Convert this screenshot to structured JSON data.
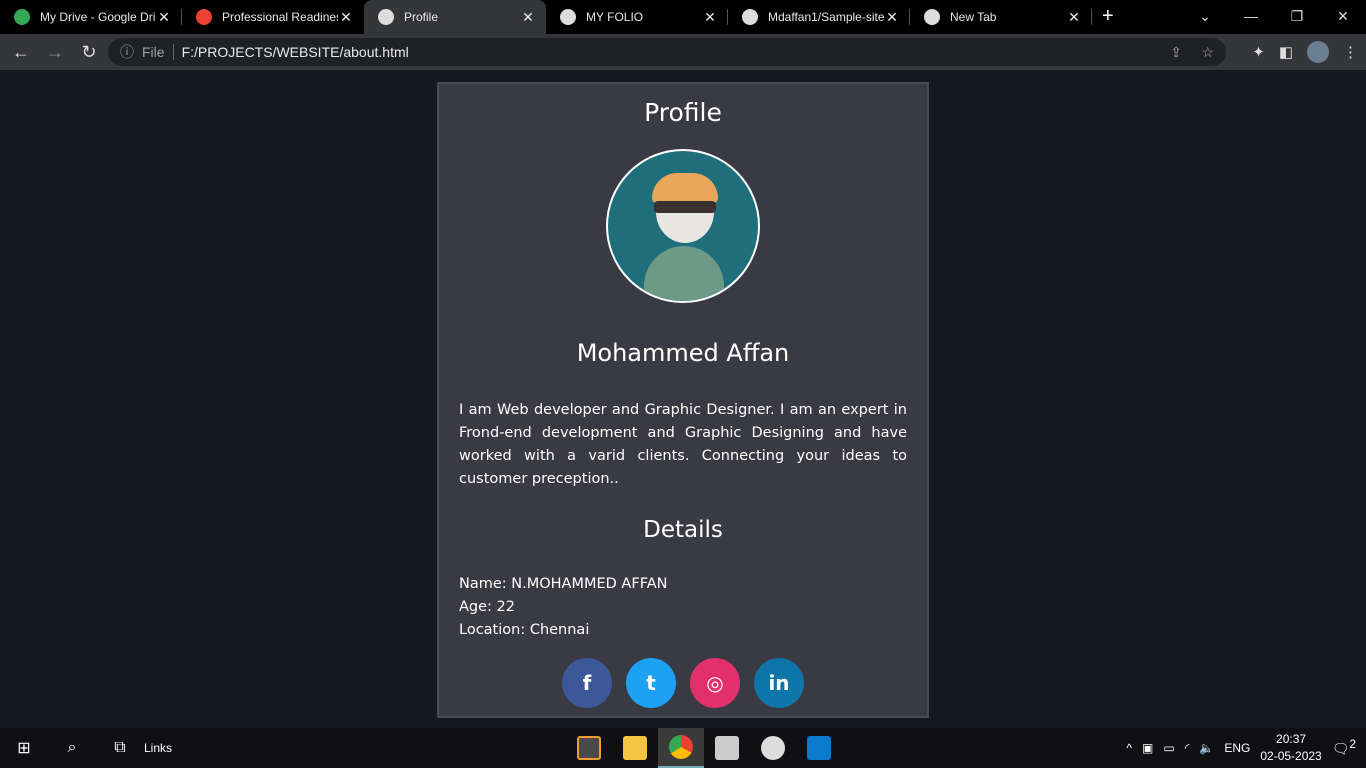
{
  "browser": {
    "tabs": [
      {
        "title": "My Drive - Google Dri",
        "color": "#34a853"
      },
      {
        "title": "Professional Readiness",
        "color": "#ea4335"
      },
      {
        "title": "Profile",
        "color": "#ddd"
      },
      {
        "title": "MY FOLIO",
        "color": "#ddd"
      },
      {
        "title": "Mdaffan1/Sample-site",
        "color": "#ddd"
      },
      {
        "title": "New Tab",
        "color": "#ddd"
      }
    ],
    "address_prefix": "File",
    "url": "F:/PROJECTS/WEBSITE/about.html"
  },
  "page": {
    "title": "Profile",
    "name": "Mohammed Affan",
    "bio": "I am Web developer and Graphic Designer. I am an expert in Frond-end development and Graphic Designing and have worked with a varid clients. Connecting your ideas to customer preception..",
    "details_heading": "Details",
    "details": [
      "Name: N.MOHAMMED AFFAN",
      "Age: 22",
      "Location: Chennai"
    ],
    "social": [
      {
        "name": "facebook",
        "glyph": "f",
        "color": "#3b5998"
      },
      {
        "name": "twitter",
        "glyph": "t",
        "color": "#1da1f2"
      },
      {
        "name": "instagram",
        "glyph": "◎",
        "color": "#e1306c"
      },
      {
        "name": "linkedin",
        "glyph": "in",
        "color": "#0e76a8"
      }
    ]
  },
  "taskbar": {
    "links_label": "Links",
    "lang": "ENG",
    "time": "20:37",
    "date": "02-05-2023",
    "notifications": "2"
  }
}
